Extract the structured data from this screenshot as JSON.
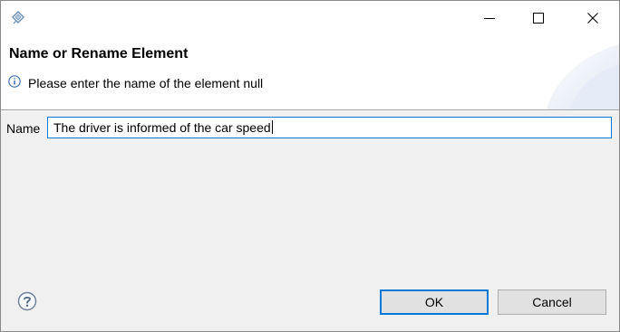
{
  "dialog": {
    "title": "Name or Rename Element",
    "message": "Please enter the name of the element null"
  },
  "form": {
    "name_label": "Name",
    "name_value": "The driver is informed of the car speed"
  },
  "buttons": {
    "ok_label": "OK",
    "cancel_label": "Cancel"
  },
  "icons": {
    "app": "app-diamond-icon",
    "minimize": "minimize-icon",
    "maximize": "maximize-icon",
    "close": "close-icon",
    "info": "info-icon",
    "help": "help-icon"
  },
  "colors": {
    "accent": "#0078d7",
    "button_bg": "#e1e1e1",
    "dialog_bg": "#f0f0f0",
    "header_bg": "#ffffff"
  }
}
